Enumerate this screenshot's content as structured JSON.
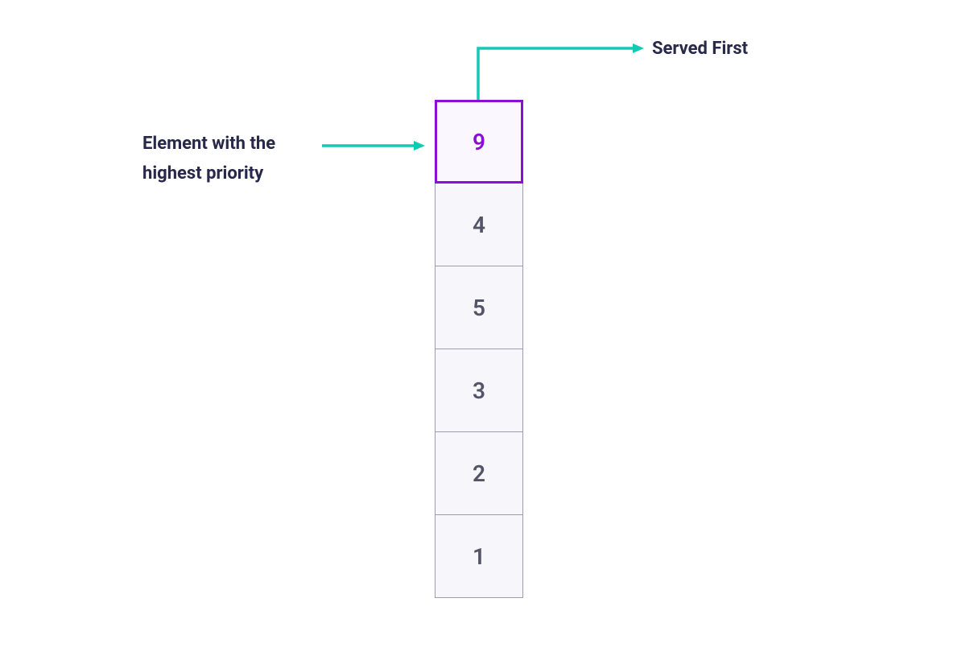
{
  "colors": {
    "accent_purple": "#8a0fd4",
    "accent_teal": "#12c9b4",
    "text": "#28284a",
    "cell_border": "#9e9caf",
    "cell_bg": "#f6f6fb"
  },
  "labels": {
    "left_line1": "Element with the",
    "left_line2": "highest priority",
    "right": "Served First"
  },
  "queue": {
    "top": "9",
    "items": [
      "4",
      "5",
      "3",
      "2",
      "1"
    ]
  }
}
